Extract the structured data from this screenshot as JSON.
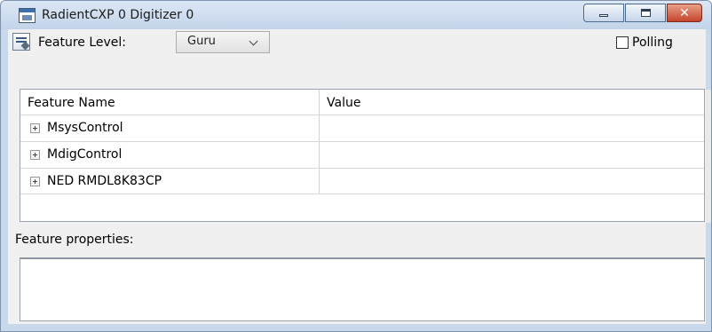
{
  "window": {
    "title": "RadientCXP 0 Digitizer 0",
    "accent_color": "#c9d9ec",
    "close_color": "#c7442c"
  },
  "toolbar": {
    "icon": "properties-icon",
    "feature_level_label": "Feature Level:",
    "feature_level_value": "Guru",
    "polling_label": "Polling",
    "polling_checked": false
  },
  "grid": {
    "columns": [
      "Feature Name",
      "Value"
    ],
    "rows": [
      {
        "name": "MsysControl",
        "value": ""
      },
      {
        "name": "MdigControl",
        "value": ""
      },
      {
        "name": "NED RMDL8K83CP",
        "value": ""
      }
    ]
  },
  "properties": {
    "label": "Feature properties:",
    "content": ""
  }
}
